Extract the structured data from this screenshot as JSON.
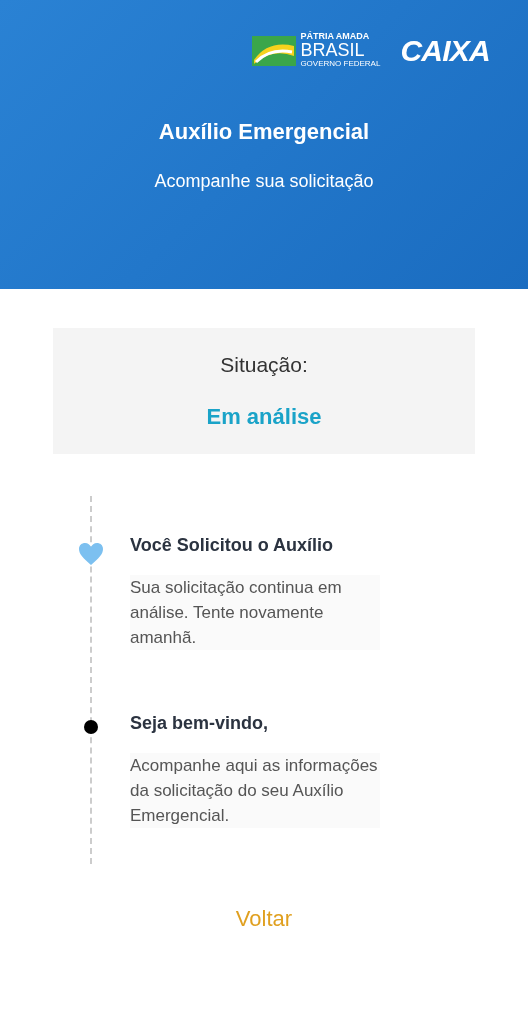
{
  "header": {
    "brand": {
      "line1": "PÁTRIA AMADA",
      "line2": "BRASIL",
      "line3": "GOVERNO FEDERAL"
    },
    "bank": "CAIXA",
    "title": "Auxílio Emergencial",
    "subtitle": "Acompanhe sua solicitação"
  },
  "status": {
    "label": "Situação:",
    "value": "Em análise"
  },
  "timeline": [
    {
      "kind": "heart",
      "title": "Você Solicitou o Auxílio",
      "text": "Sua solicitação continua em análise. Tente novamente amanhã."
    },
    {
      "kind": "dot",
      "title": "Seja bem-vindo,",
      "text": "Acompanhe aqui as informações da solicitação do seu Auxílio Emergencial."
    }
  ],
  "back_link": "Voltar"
}
